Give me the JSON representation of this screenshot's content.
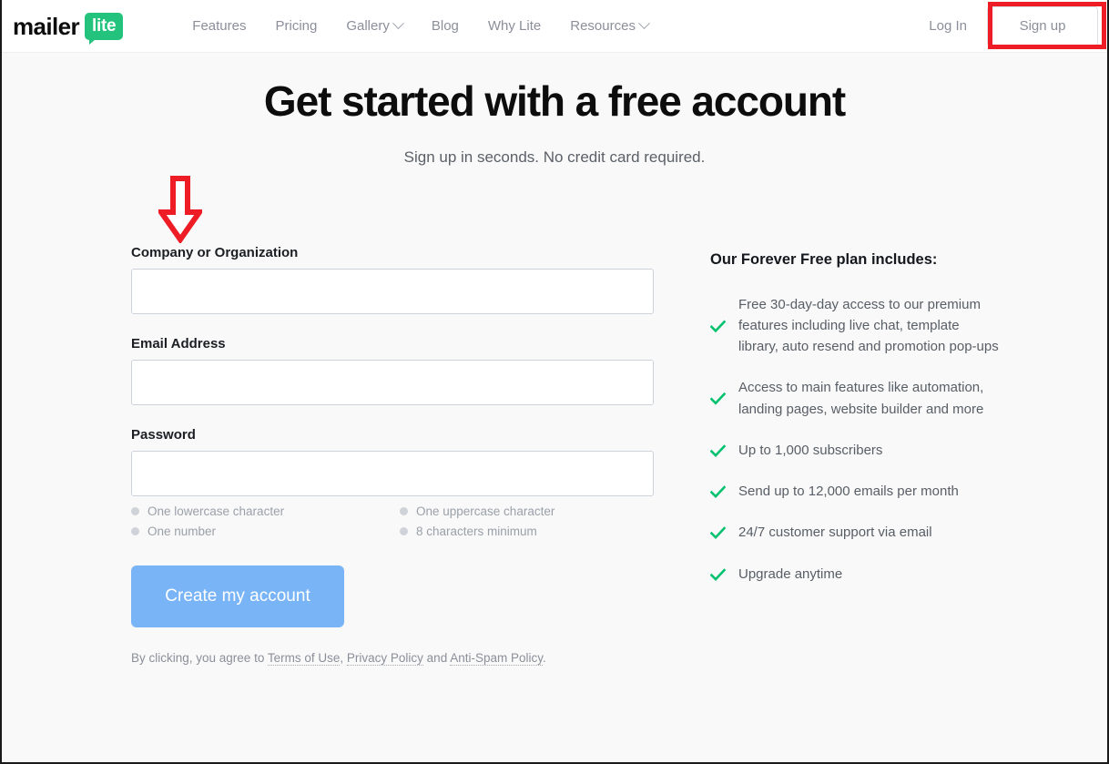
{
  "header": {
    "brand": {
      "word": "mailer",
      "badge": "lite"
    },
    "nav": [
      {
        "label": "Features",
        "icon": null
      },
      {
        "label": "Pricing",
        "icon": null
      },
      {
        "label": "Gallery",
        "icon": "chevron-down-icon"
      },
      {
        "label": "Blog",
        "icon": null
      },
      {
        "label": "Why Lite",
        "icon": null
      },
      {
        "label": "Resources",
        "icon": "chevron-down-icon"
      }
    ],
    "login_label": "Log In",
    "signup_label": "Sign up"
  },
  "hero": {
    "title": "Get started with a free account",
    "subtitle": "Sign up in seconds. No credit card required."
  },
  "form": {
    "fields": [
      {
        "label": "Company or Organization",
        "value": "",
        "placeholder": ""
      },
      {
        "label": "Email Address",
        "value": "",
        "placeholder": ""
      },
      {
        "label": "Password",
        "value": "",
        "placeholder": ""
      }
    ],
    "password_requirements": [
      "One lowercase character",
      "One uppercase character",
      "One number",
      "8 characters minimum"
    ],
    "submit_label": "Create my account",
    "legal": {
      "prefix": "By clicking, you agree to ",
      "link1": "Terms of Use",
      "sep1": ", ",
      "link2": "Privacy Policy",
      "sep2": " and ",
      "link3": "Anti-Spam Policy",
      "suffix": "."
    }
  },
  "benefits": {
    "title": "Our Forever Free plan includes:",
    "items": [
      "Free 30-day-day access to our premium features including live chat, template library, auto resend and promotion pop-ups",
      "Access to main features like automation, landing pages, website builder and more",
      "Up to 1,000 subscribers",
      "Send up to 12,000 emails per month",
      "24/7 customer support via email",
      "Upgrade anytime"
    ],
    "item_icon": "check-icon"
  },
  "annotations": {
    "highlight_box": {
      "target": "signup-button",
      "color": "#ee1c25"
    },
    "arrow": {
      "target": "company-field-label",
      "direction": "down",
      "color": "#ee1c25"
    }
  },
  "colors": {
    "brand_green": "#24c37d",
    "check_green": "#00c16e",
    "cta_blue": "#79b4f7",
    "annotation_red": "#ee1c25",
    "page_bg": "#f9f9f9"
  }
}
